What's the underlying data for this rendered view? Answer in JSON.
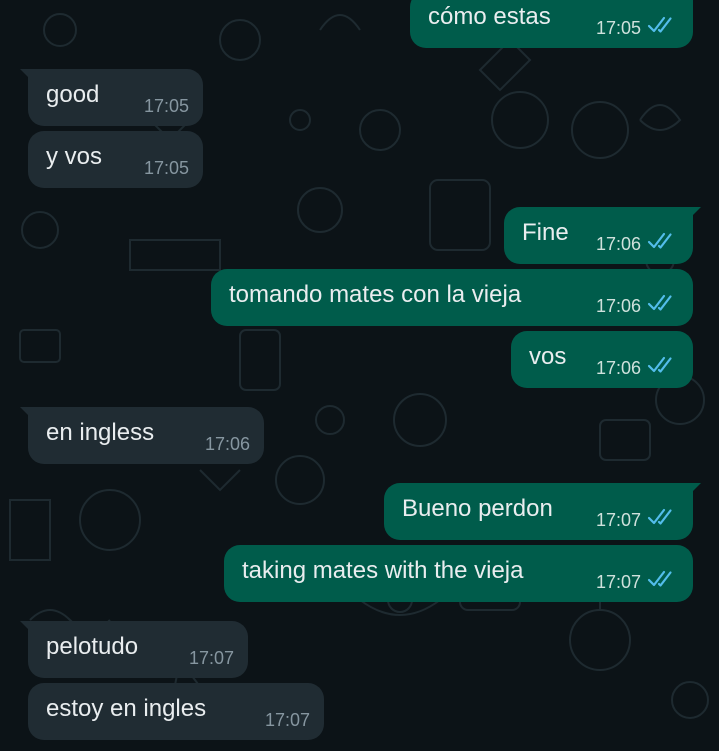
{
  "messages": [
    {
      "direction": "out",
      "text": "cómo estas",
      "time": "17:05",
      "status": "read-double-check-icon"
    },
    {
      "direction": "in",
      "text": "good",
      "time": "17:05"
    },
    {
      "direction": "in",
      "text": "y vos",
      "time": "17:05"
    },
    {
      "direction": "out",
      "text": "Fine",
      "time": "17:06",
      "status": "read-double-check-icon"
    },
    {
      "direction": "out",
      "text": "tomando mates con la vieja",
      "time": "17:06",
      "status": "read-double-check-icon"
    },
    {
      "direction": "out",
      "text": "vos",
      "time": "17:06",
      "status": "read-double-check-icon"
    },
    {
      "direction": "in",
      "text": "en ingless",
      "time": "17:06"
    },
    {
      "direction": "out",
      "text": "Bueno perdon",
      "time": "17:07",
      "status": "read-double-check-icon"
    },
    {
      "direction": "out",
      "text": "taking mates with the vieja",
      "time": "17:07",
      "status": "read-double-check-icon"
    },
    {
      "direction": "in",
      "text": "pelotudo",
      "time": "17:07"
    },
    {
      "direction": "in",
      "text": "estoy en ingles",
      "time": "17:07"
    }
  ],
  "colors": {
    "background": "#0c1317",
    "outgoing_bubble": "#005c4b",
    "incoming_bubble": "#202c33",
    "read_tick": "#53bdeb"
  }
}
